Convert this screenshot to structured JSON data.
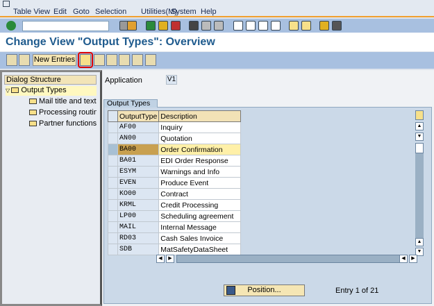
{
  "menu": [
    "Table View",
    "Edit",
    "Goto",
    "Selection",
    "Utilities(M)",
    "System",
    "Help"
  ],
  "title": "Change View \"Output Types\": Overview",
  "app_toolbar": {
    "new_entries": "New Entries"
  },
  "dialog_structure": {
    "header": "Dialog Structure",
    "root": "Output Types",
    "children": [
      "Mail title and texts",
      "Processing routines",
      "Partner functions"
    ]
  },
  "application": {
    "label": "Application",
    "value": "V1"
  },
  "group_title": "Output Types",
  "table": {
    "columns": [
      "OutputType",
      "Description"
    ],
    "rows": [
      [
        "AF00",
        "Inquiry"
      ],
      [
        "AN00",
        "Quotation"
      ],
      [
        "BA00",
        "Order Confirmation"
      ],
      [
        "BA01",
        "EDI Order Response"
      ],
      [
        "ESYM",
        "Warnings and Info"
      ],
      [
        "EVEN",
        "Produce Event"
      ],
      [
        "KO00",
        "Contract"
      ],
      [
        "KRML",
        "Credit Processing"
      ],
      [
        "LP00",
        "Scheduling agreement"
      ],
      [
        "MAIL",
        "Internal Message"
      ],
      [
        "RD03",
        "Cash Sales Invoice"
      ],
      [
        "SDB",
        "MatSafetyDataSheet"
      ]
    ],
    "selected_row": 2
  },
  "position_button": "Position...",
  "entry_info": "Entry 1 of 21",
  "colors": {
    "toolbar": "#a8c0e0",
    "title": "#1f5b8e",
    "group": "#cbd9e8",
    "highlight": "#e00000"
  }
}
